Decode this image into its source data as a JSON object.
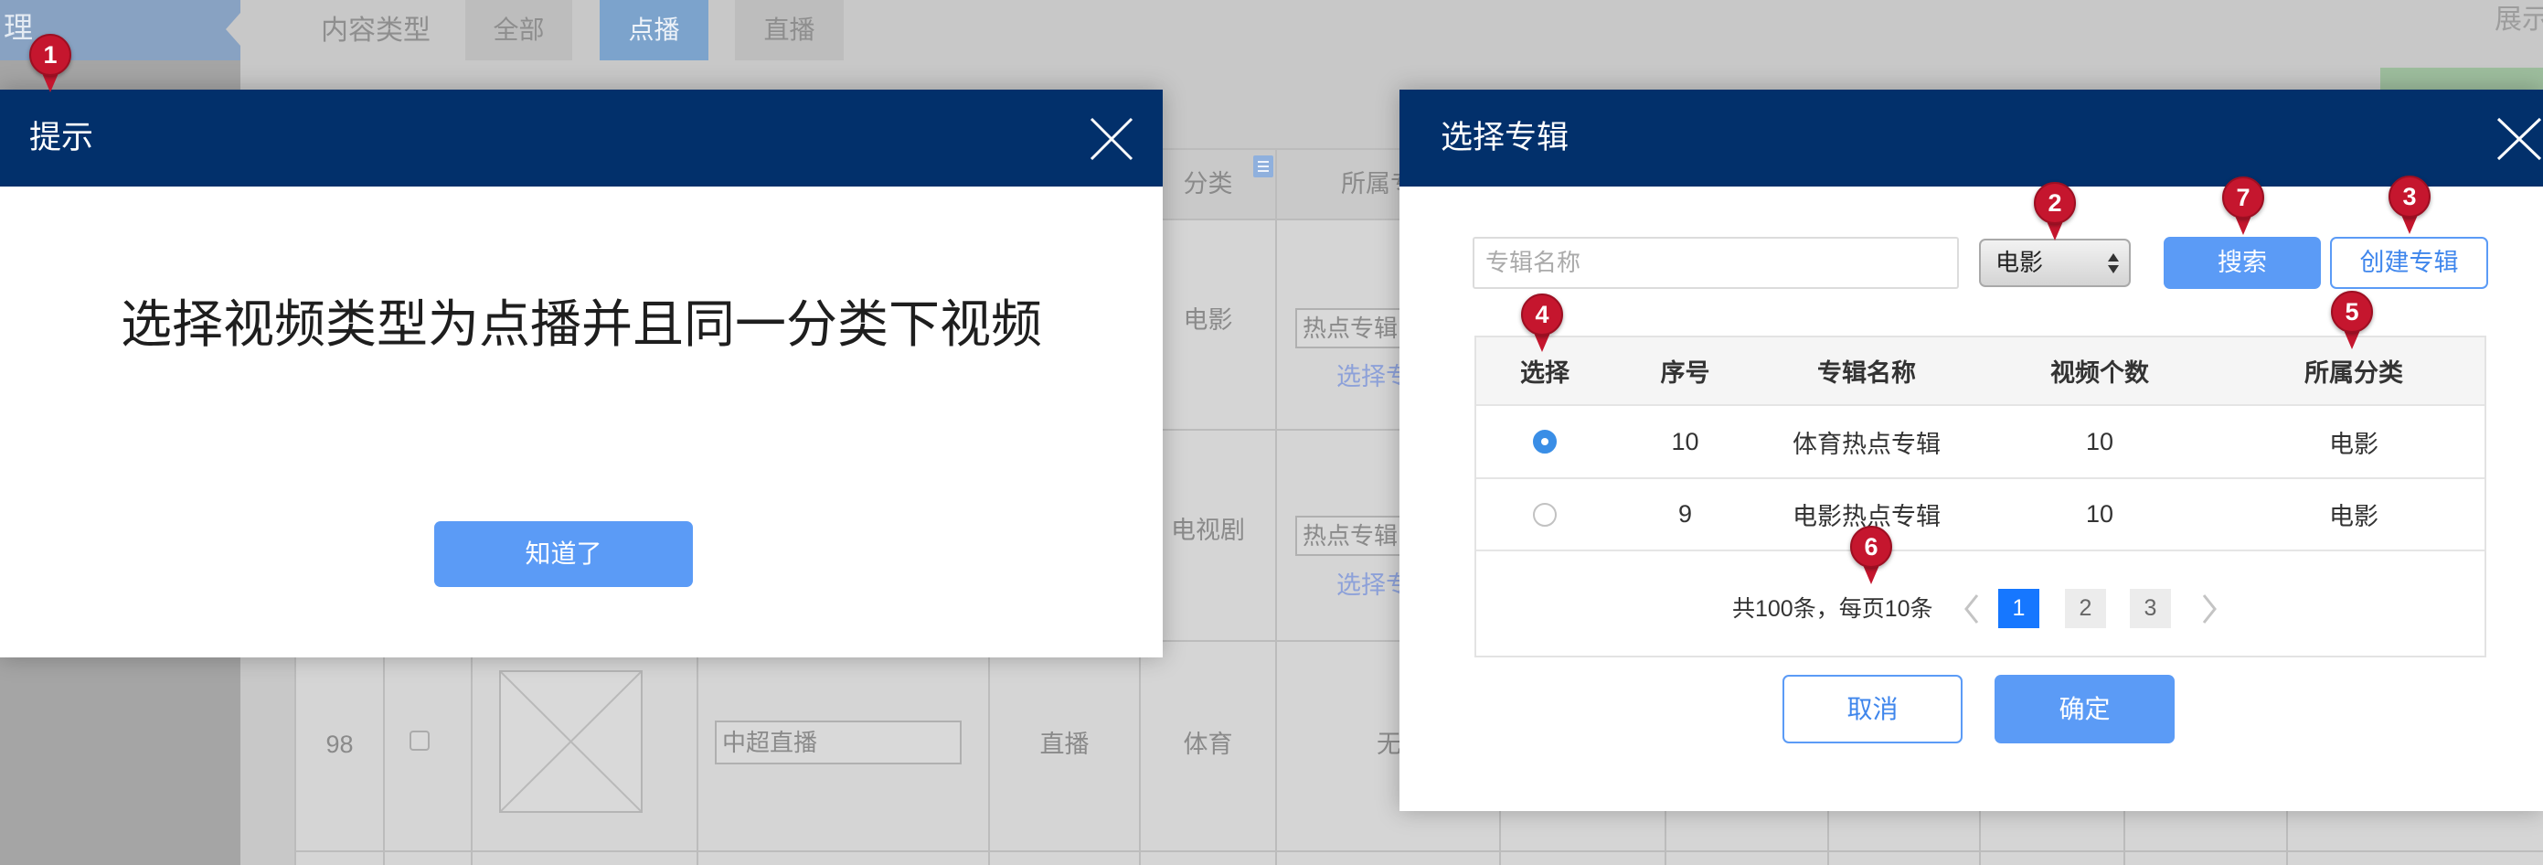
{
  "colors": {
    "header_navy": "#02306b",
    "primary_blue": "#5b9bf6",
    "page_active": "#1677ff",
    "marker_red": "#c5162e"
  },
  "background_page": {
    "sidebar": {
      "active_label": "理"
    },
    "filter": {
      "label": "内容类型",
      "options": [
        {
          "label": "全部",
          "active": false
        },
        {
          "label": "点播",
          "active": true
        },
        {
          "label": "直播",
          "active": false
        }
      ]
    },
    "top_right_label": "展示",
    "table": {
      "headers": {
        "category": "分类",
        "album": "所属专"
      },
      "rows": [
        {
          "category": "电影",
          "album_value": "热点专辑",
          "album_link": "选择专"
        },
        {
          "category": "电视剧",
          "album_value": "热点专辑",
          "album_link": "选择专"
        },
        {
          "id": "98",
          "title_value": "中超直播",
          "type": "直播",
          "category": "体育",
          "album": "无"
        }
      ]
    }
  },
  "hint_dialog": {
    "title": "提示",
    "message": "选择视频类型为点播并且同一分类下视频",
    "confirm_label": "知道了"
  },
  "album_dialog": {
    "title": "选择专辑",
    "search_placeholder": "专辑名称",
    "category_select": "电影",
    "search_label": "搜索",
    "create_label": "创建专辑",
    "columns": [
      "选择",
      "序号",
      "专辑名称",
      "视频个数",
      "所属分类"
    ],
    "rows": [
      {
        "selected": true,
        "index": "10",
        "name": "体育热点专辑",
        "video_count": "10",
        "category": "电影"
      },
      {
        "selected": false,
        "index": "9",
        "name": "电影热点专辑",
        "video_count": "10",
        "category": "电影"
      }
    ],
    "pagination": {
      "summary": "共100条，每页10条",
      "pages": [
        {
          "label": "1",
          "active": true
        },
        {
          "label": "2",
          "active": false
        },
        {
          "label": "3",
          "active": false
        }
      ]
    },
    "cancel_label": "取消",
    "ok_label": "确定"
  },
  "annotation_markers": [
    "1",
    "2",
    "3",
    "4",
    "5",
    "6",
    "7"
  ]
}
